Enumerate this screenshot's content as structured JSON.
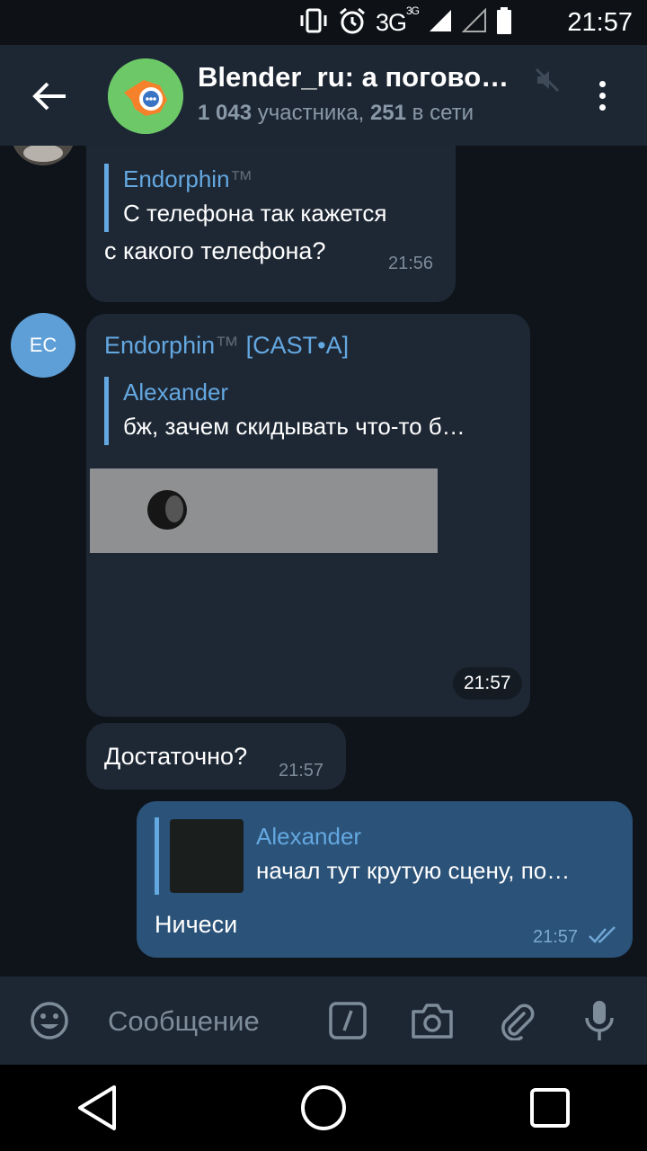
{
  "status_bar": {
    "network": "3G",
    "network_sup": "3G",
    "time": "21:57"
  },
  "header": {
    "title": "Blender_ru: а погово…",
    "members_count": "1 043",
    "members_label": "участника,",
    "online_count": "251",
    "online_label": "в сети"
  },
  "messages": [
    {
      "reply_name": "Endorphin",
      "reply_name_tm": "™",
      "reply_text": "С телефона так кажется",
      "text": "с какого телефона?",
      "time": "21:56"
    },
    {
      "avatar_initials": "EC",
      "sender": "Endorphin",
      "sender_tm": "™",
      "sender_tag": "[CAST•A]",
      "reply_name": "Alexander",
      "reply_text": "бж, зачем скидывать что-то б…",
      "time": "21:57"
    },
    {
      "text": "Достаточно?",
      "time": "21:57"
    },
    {
      "reply_name": "Alexander",
      "reply_text": "начал тут крутую сцену, по…",
      "text": "Ничеси",
      "time": "21:57",
      "outgoing": true,
      "read": true
    }
  ],
  "input": {
    "placeholder": "Сообщение"
  },
  "colors": {
    "header_bg": "#1d2733",
    "chat_bg": "#0f141b",
    "incoming_bubble": "#1e2835",
    "outgoing_bubble": "#2b5278",
    "accent_blue": "#64a8e1"
  }
}
